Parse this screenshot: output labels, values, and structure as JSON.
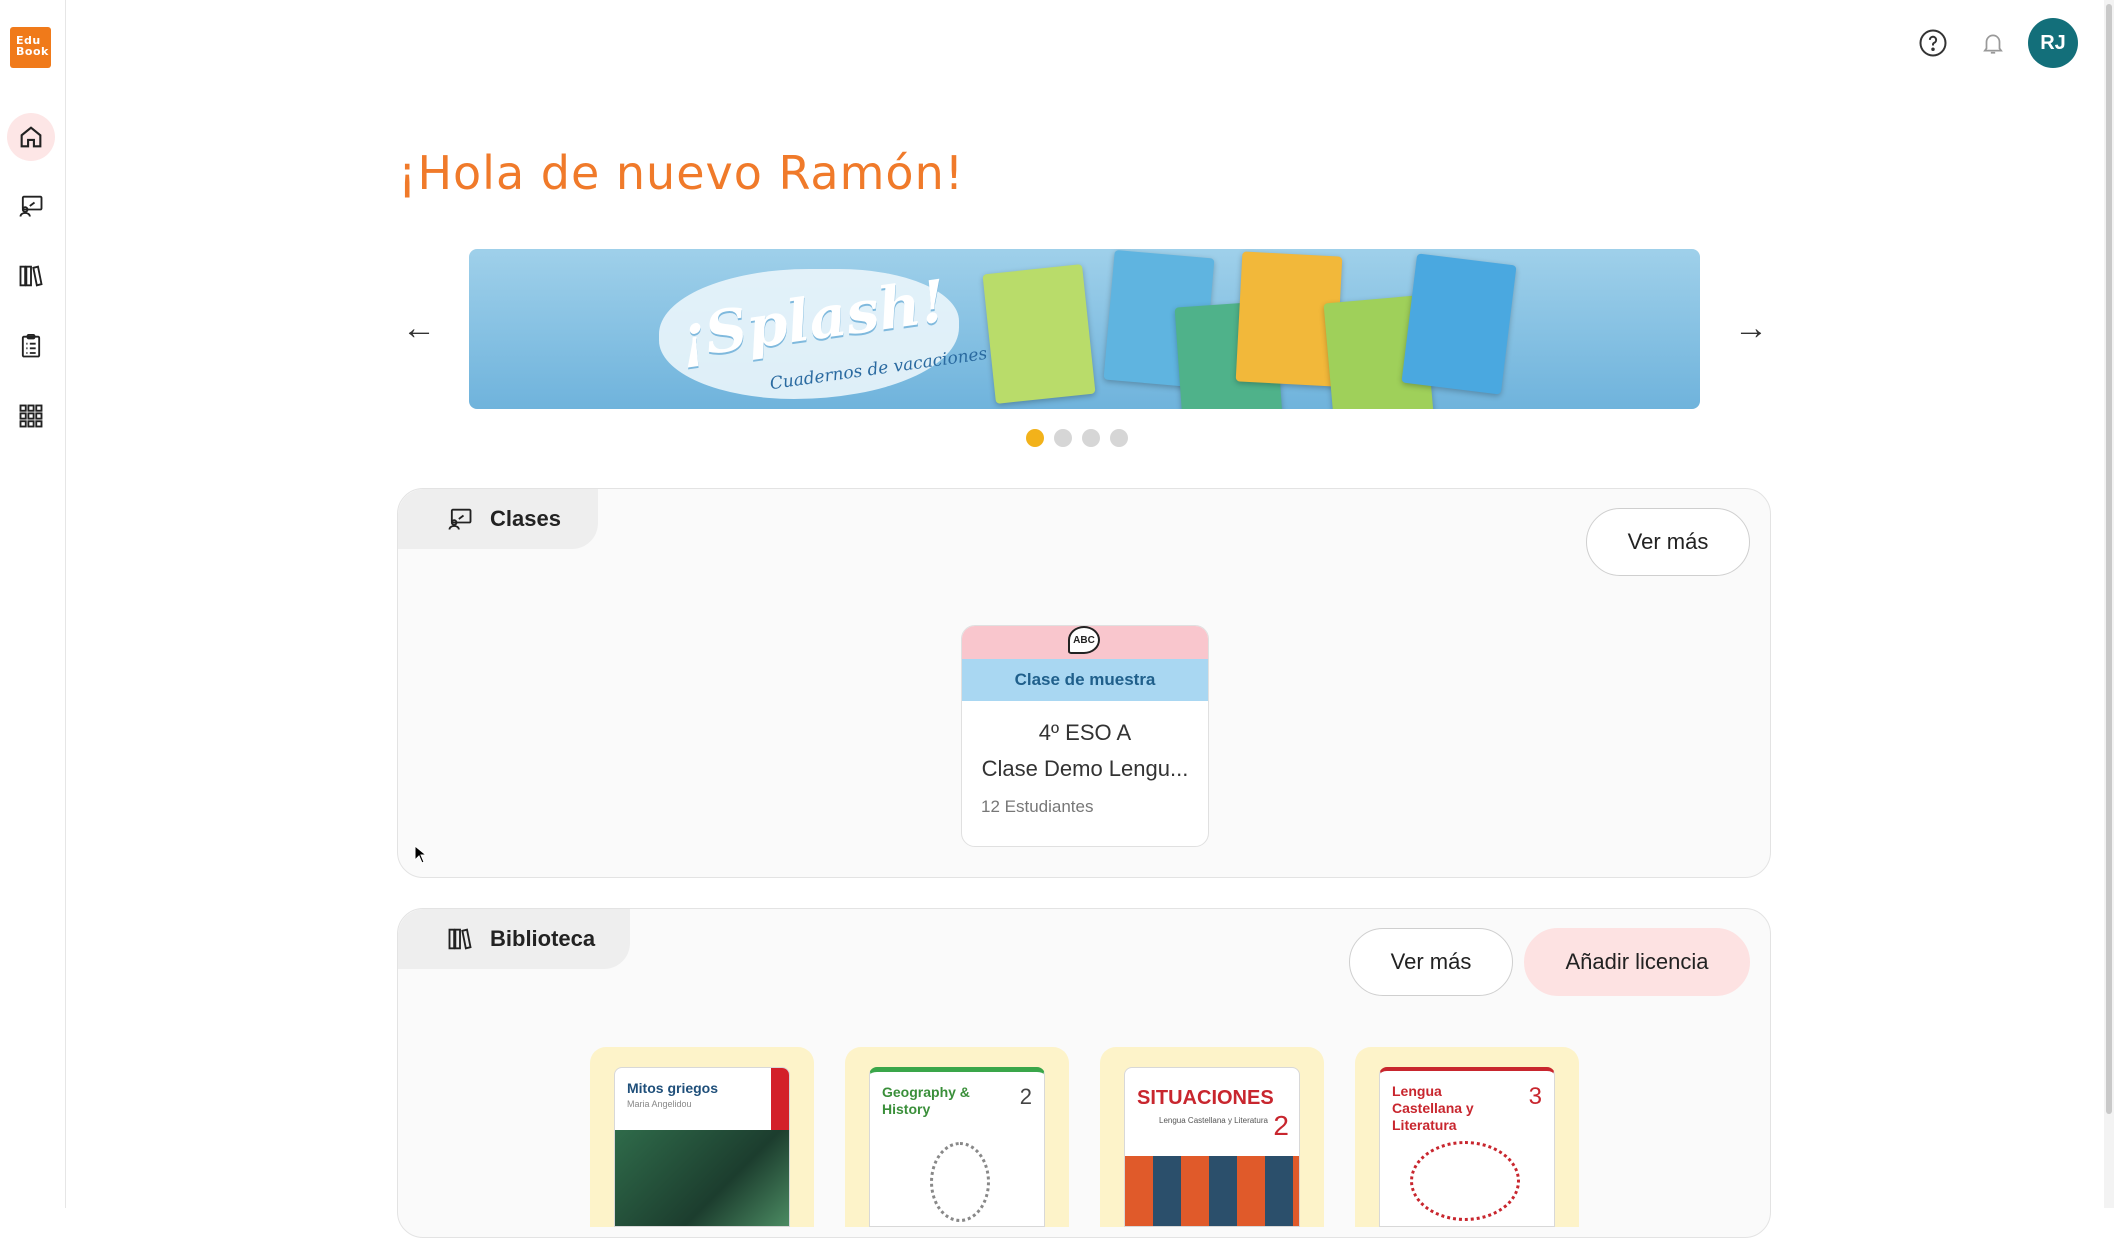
{
  "app": {
    "logo_text": "Edu Book"
  },
  "sidebar": {
    "items": [
      {
        "name": "home",
        "icon": "home-icon",
        "active": true
      },
      {
        "name": "classes",
        "icon": "classroom-icon",
        "active": false
      },
      {
        "name": "library",
        "icon": "books-icon",
        "active": false
      },
      {
        "name": "tasks",
        "icon": "clipboard-icon",
        "active": false
      },
      {
        "name": "apps",
        "icon": "grid-icon",
        "active": false
      }
    ]
  },
  "topbar": {
    "help_icon": "help-icon",
    "notifications_icon": "bell-icon",
    "avatar_initials": "RJ",
    "avatar_color": "#136f7a"
  },
  "greeting": "¡Hola de nuevo Ramón!",
  "carousel": {
    "prev_label": "←",
    "next_label": "→",
    "banner": {
      "title": "¡Splash!",
      "subtitle": "Cuadernos de vacaciones",
      "book_label": "¡Splash!"
    },
    "slides": 4,
    "active_slide": 1,
    "active_color": "#f2b21a"
  },
  "classes": {
    "title": "Clases",
    "more_label": "Ver más",
    "card": {
      "icon_text": "ABC",
      "badge": "Clase de muestra",
      "line1": "4º ESO A",
      "line2": "Clase Demo Lengu...",
      "students": "12 Estudiantes"
    }
  },
  "library": {
    "title": "Biblioteca",
    "more_label": "Ver más",
    "add_license_label": "Añadir licencia",
    "books": [
      {
        "title": "Mitos griegos",
        "author": "Maria Angelidou"
      },
      {
        "title": "Geography & History",
        "number": "2"
      },
      {
        "title": "SITUACIONES",
        "subtitle": "Lengua Castellana y Literatura",
        "number": "2"
      },
      {
        "title": "Lengua Castellana y Literatura",
        "number": "3"
      }
    ]
  },
  "colors": {
    "accent": "#f07a2a",
    "brand": "#f07a1a",
    "pink": "#fde2e2",
    "book_tile": "#fdf3c9"
  }
}
